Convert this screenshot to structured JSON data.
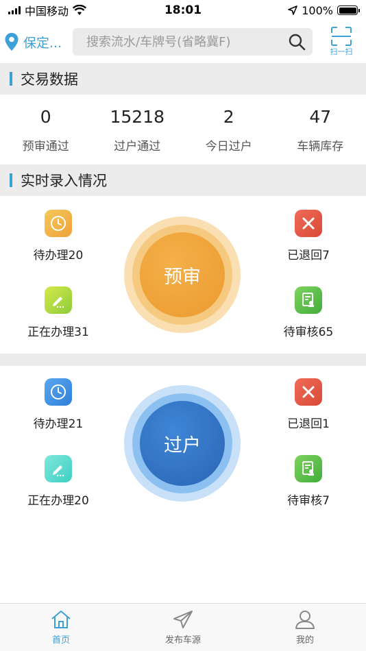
{
  "status_bar": {
    "carrier": "中国移动",
    "time": "18:01",
    "battery": "100%"
  },
  "header": {
    "location": "保定...",
    "search_placeholder": "搜索流水/车牌号(省略冀F)",
    "scan_label": "扫一扫"
  },
  "sections": {
    "trade_title": "交易数据",
    "realtime_title": "实时录入情况"
  },
  "stats": [
    {
      "value": "0",
      "label": "预审通过"
    },
    {
      "value": "15218",
      "label": "过户通过"
    },
    {
      "value": "2",
      "label": "今日过户"
    },
    {
      "value": "47",
      "label": "车辆库存"
    }
  ],
  "pre_review": {
    "center_label": "预审",
    "pending": "待办理20",
    "processing": "正在办理31",
    "returned": "已退回7",
    "awaiting_review": "待审核65"
  },
  "transfer": {
    "center_label": "过户",
    "pending": "待办理21",
    "processing": "正在办理20",
    "returned": "已退回1",
    "awaiting_review": "待审核7"
  },
  "tabs": [
    {
      "label": "首页"
    },
    {
      "label": "发布车源"
    },
    {
      "label": "我的"
    }
  ],
  "colors": {
    "accent": "#3da0d6",
    "orange": "#f0a33a",
    "blue": "#2f74c6",
    "red": "#e0513d",
    "green": "#58c04a"
  }
}
